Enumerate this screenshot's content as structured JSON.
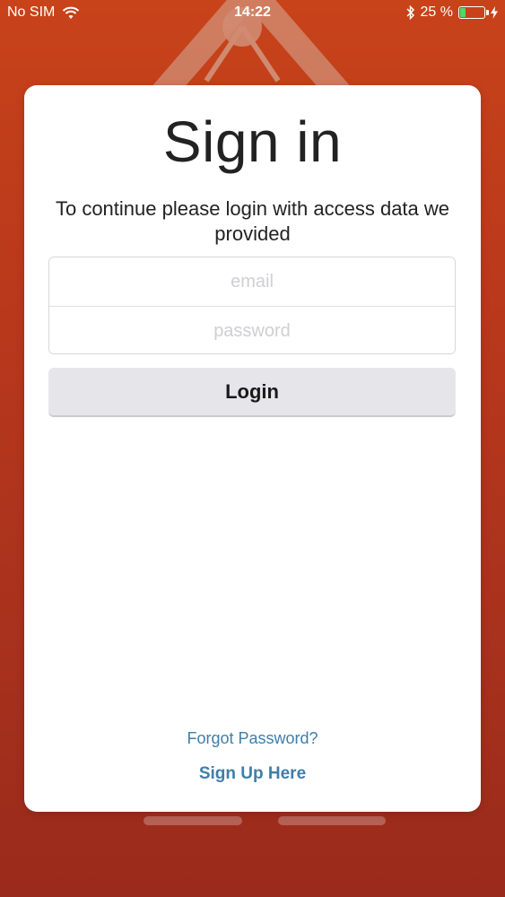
{
  "status_bar": {
    "carrier": "No SIM",
    "time": "14:22",
    "battery_percent": "25 %",
    "battery_level": 0.25,
    "icons": [
      "wifi-icon",
      "bluetooth-icon",
      "battery-icon",
      "charging-icon"
    ]
  },
  "login": {
    "title": "Sign in",
    "subtitle": "To continue please login with access data we provided",
    "email": {
      "placeholder": "email",
      "value": ""
    },
    "password": {
      "placeholder": "password",
      "value": ""
    },
    "login_label": "Login",
    "forgot_label": "Forgot Password?",
    "signup_label": "Sign Up Here"
  },
  "colors": {
    "background": "#b9381c",
    "link": "#3f7eaa",
    "button_bg": "#e6e6ea",
    "battery_fill": "#4cd964"
  }
}
